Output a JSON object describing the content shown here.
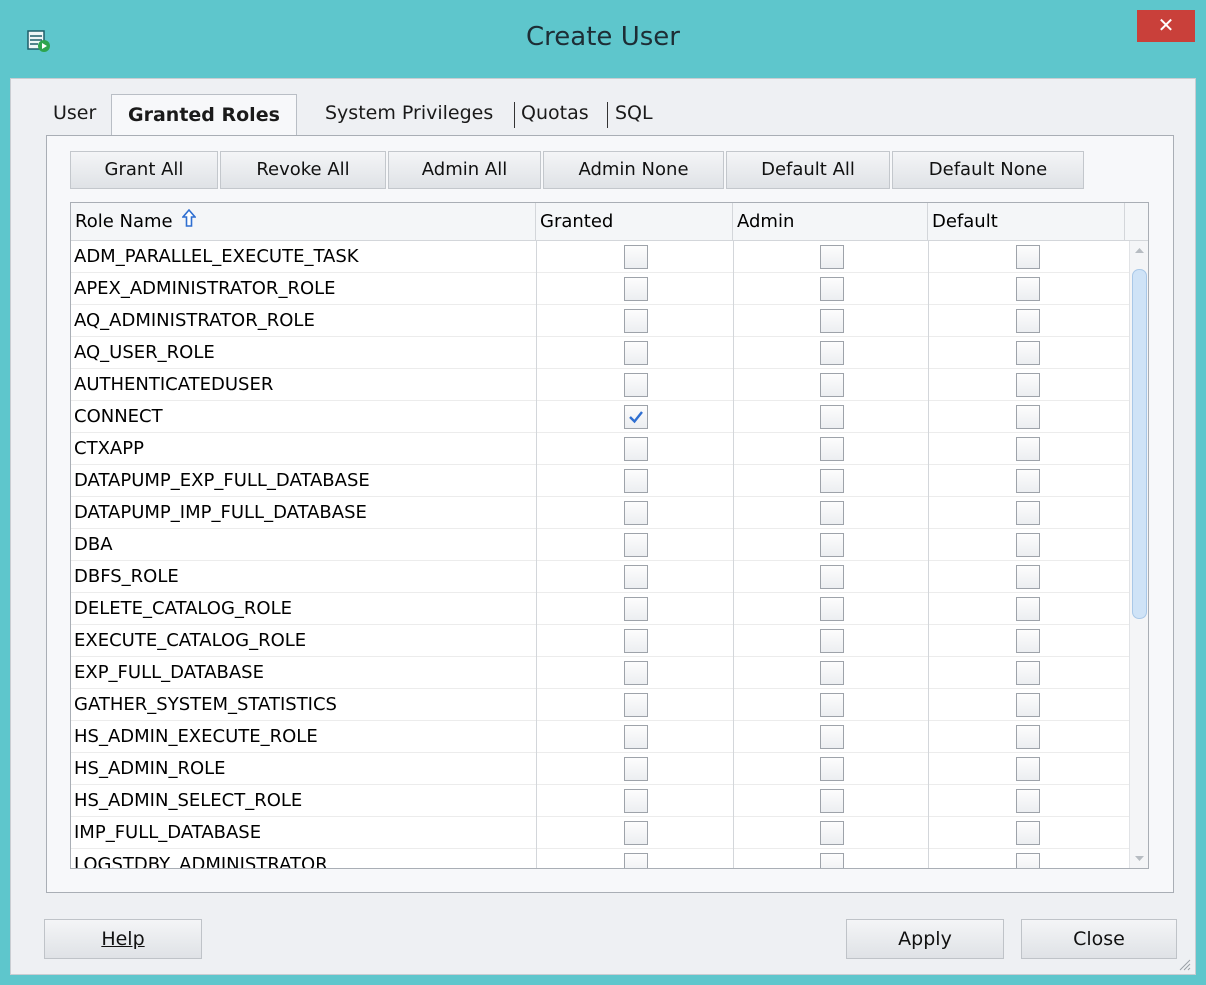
{
  "window": {
    "title": "Create User",
    "close_glyph": "✕"
  },
  "tabs": [
    {
      "label": "User",
      "active": false
    },
    {
      "label": "Granted Roles",
      "active": true
    },
    {
      "label": "System Privileges",
      "active": false
    },
    {
      "label": "Quotas",
      "active": false
    },
    {
      "label": "SQL",
      "active": false
    }
  ],
  "toolbar": {
    "grant_all": "Grant All",
    "revoke_all": "Revoke All",
    "admin_all": "Admin All",
    "admin_none": "Admin None",
    "default_all": "Default All",
    "default_none": "Default None"
  },
  "table": {
    "columns": [
      "Role Name",
      "Granted",
      "Admin",
      "Default"
    ],
    "sort_indicator": "ascending",
    "rows": [
      {
        "role": "ADM_PARALLEL_EXECUTE_TASK",
        "granted": false,
        "admin": false,
        "default": false
      },
      {
        "role": "APEX_ADMINISTRATOR_ROLE",
        "granted": false,
        "admin": false,
        "default": false
      },
      {
        "role": "AQ_ADMINISTRATOR_ROLE",
        "granted": false,
        "admin": false,
        "default": false
      },
      {
        "role": "AQ_USER_ROLE",
        "granted": false,
        "admin": false,
        "default": false
      },
      {
        "role": "AUTHENTICATEDUSER",
        "granted": false,
        "admin": false,
        "default": false
      },
      {
        "role": "CONNECT",
        "granted": true,
        "admin": false,
        "default": false
      },
      {
        "role": "CTXAPP",
        "granted": false,
        "admin": false,
        "default": false
      },
      {
        "role": "DATAPUMP_EXP_FULL_DATABASE",
        "granted": false,
        "admin": false,
        "default": false
      },
      {
        "role": "DATAPUMP_IMP_FULL_DATABASE",
        "granted": false,
        "admin": false,
        "default": false
      },
      {
        "role": "DBA",
        "granted": false,
        "admin": false,
        "default": false
      },
      {
        "role": "DBFS_ROLE",
        "granted": false,
        "admin": false,
        "default": false
      },
      {
        "role": "DELETE_CATALOG_ROLE",
        "granted": false,
        "admin": false,
        "default": false
      },
      {
        "role": "EXECUTE_CATALOG_ROLE",
        "granted": false,
        "admin": false,
        "default": false
      },
      {
        "role": "EXP_FULL_DATABASE",
        "granted": false,
        "admin": false,
        "default": false
      },
      {
        "role": "GATHER_SYSTEM_STATISTICS",
        "granted": false,
        "admin": false,
        "default": false
      },
      {
        "role": "HS_ADMIN_EXECUTE_ROLE",
        "granted": false,
        "admin": false,
        "default": false
      },
      {
        "role": "HS_ADMIN_ROLE",
        "granted": false,
        "admin": false,
        "default": false
      },
      {
        "role": "HS_ADMIN_SELECT_ROLE",
        "granted": false,
        "admin": false,
        "default": false
      },
      {
        "role": "IMP_FULL_DATABASE",
        "granted": false,
        "admin": false,
        "default": false
      },
      {
        "role": "LOGSTDBY_ADMINISTRATOR",
        "granted": false,
        "admin": false,
        "default": false
      }
    ]
  },
  "footer": {
    "help": "Help",
    "apply": "Apply",
    "close": "Close"
  },
  "colors": {
    "title_bar": "#5ec6cc",
    "close_button": "#c9403a",
    "check_accent": "#2f6fd1"
  }
}
